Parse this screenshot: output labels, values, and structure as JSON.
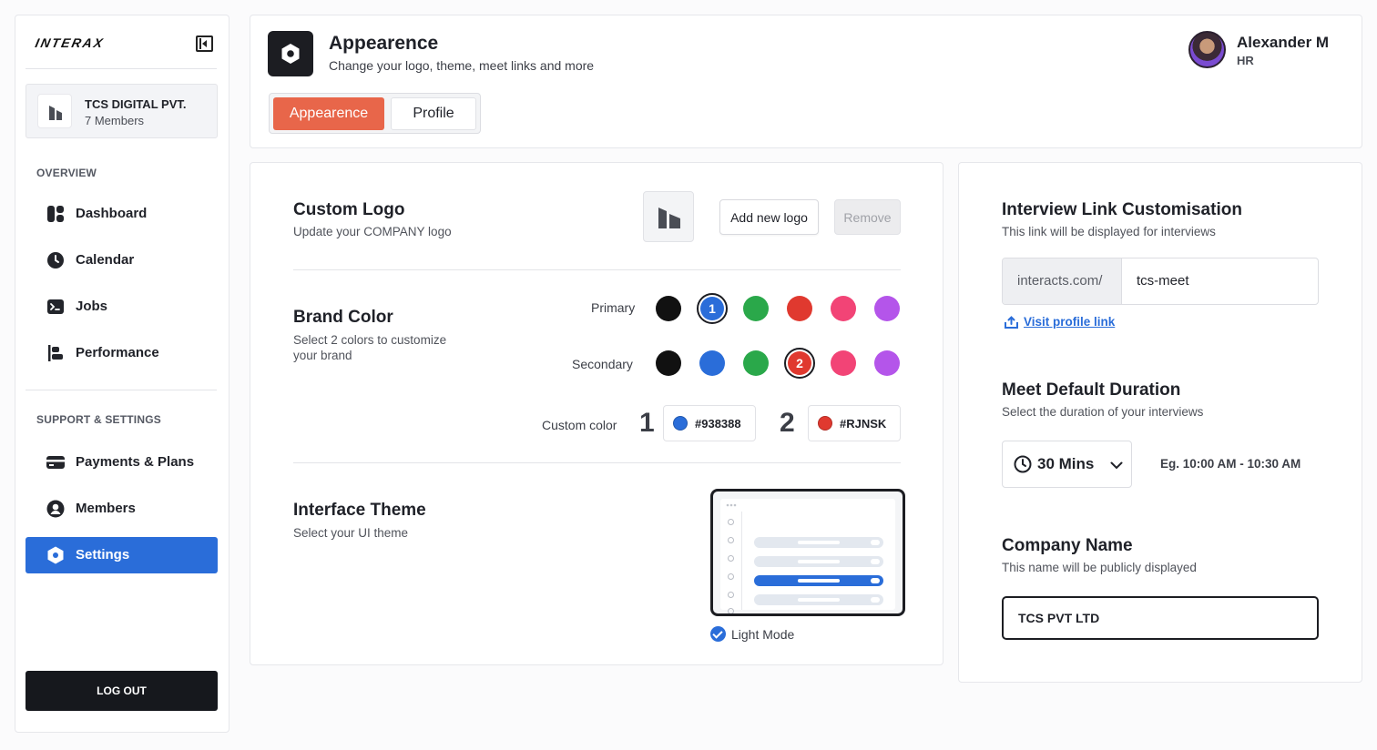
{
  "sidebar": {
    "brand": "INTERAX",
    "company": {
      "name": "TCS DIGITAL PVT.",
      "members": "7 Members"
    },
    "overview_label": "OVERVIEW",
    "overview_items": [
      {
        "label": "Dashboard",
        "icon": "dashboard-icon"
      },
      {
        "label": "Calendar",
        "icon": "clock-icon"
      },
      {
        "label": "Jobs",
        "icon": "terminal-icon"
      },
      {
        "label": "Performance",
        "icon": "performance-icon"
      }
    ],
    "support_label": "SUPPORT & SETTINGS",
    "support_items": [
      {
        "label": "Payments & Plans",
        "icon": "card-icon"
      },
      {
        "label": "Members",
        "icon": "user-icon"
      },
      {
        "label": "Settings",
        "icon": "hexagon-icon",
        "active": true
      }
    ],
    "logout": "LOG OUT"
  },
  "header": {
    "title": "Appearence",
    "subtitle": "Change your logo, theme, meet links and more",
    "tabs": [
      "Appearence",
      "Profile"
    ],
    "user": {
      "name": "Alexander M",
      "role": "HR"
    }
  },
  "custom_logo": {
    "title": "Custom Logo",
    "subtitle": "Update your COMPANY logo",
    "add_label": "Add new logo",
    "remove_label": "Remove"
  },
  "brand_color": {
    "title": "Brand Color",
    "subtitle": "Select 2 colors to customize your brand",
    "primary_label": "Primary",
    "secondary_label": "Secondary",
    "palette": [
      "#111111",
      "#2a6dd9",
      "#2aa84a",
      "#e0392f",
      "#f24476",
      "#b455ea"
    ],
    "primary_selected_marker": "1",
    "secondary_selected_marker": "2",
    "custom_label": "Custom color",
    "custom": [
      {
        "num": "1",
        "hex": "#938388",
        "swatch": "#2a6dd9"
      },
      {
        "num": "2",
        "hex": "#RJNSK",
        "swatch": "#e0392f"
      }
    ]
  },
  "interface_theme": {
    "title": "Interface Theme",
    "subtitle": "Select your UI theme",
    "option": "Light Mode"
  },
  "interview_link": {
    "title": "Interview Link Customisation",
    "subtitle": "This link will be displayed for interviews",
    "prefix": "interacts.com/",
    "value": "tcs-meet",
    "visit": "Visit profile link"
  },
  "meet_duration": {
    "title": "Meet Default Duration",
    "subtitle": "Select the duration of your interviews",
    "value": "30 Mins",
    "example": "Eg. 10:00 AM - 10:30 AM"
  },
  "company_name": {
    "title": "Company Name",
    "subtitle": "This name will be publicly displayed",
    "value": "TCS PVT LTD"
  },
  "colors": {
    "accent": "#2a6dd9",
    "tab_active": "#e8664a",
    "dark": "#1c1d22"
  }
}
